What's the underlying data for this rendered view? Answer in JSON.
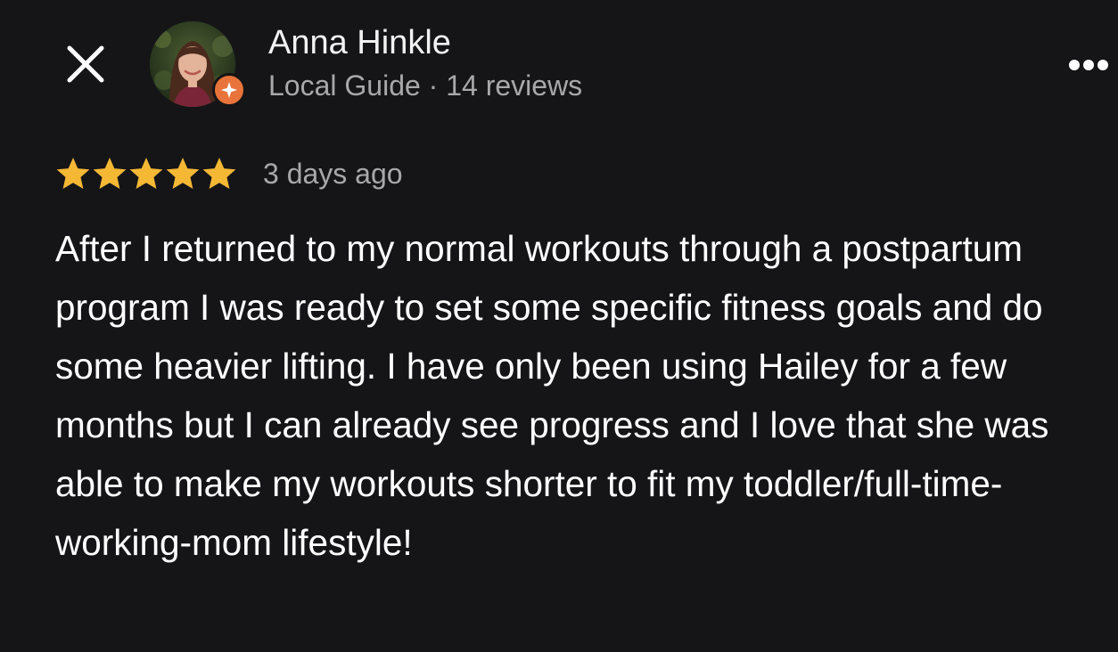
{
  "reviewer": {
    "name": "Anna Hinkle",
    "meta": "Local Guide · 14 reviews",
    "avatar_icon": "user-avatar-photo",
    "badge_icon": "local-guide-badge-icon",
    "badge_color": "#e8743b"
  },
  "review": {
    "rating": 5,
    "max_rating": 5,
    "date": "3 days ago",
    "text": "After I returned to my normal workouts through a postpartum program I was ready to set some specific fitness goals and do some heavier lifting. I have only been using Hailey for a few months but I can already see progress and I love that she was able to make my workouts shorter to fit my toddler/full-time-working-mom lifestyle!"
  },
  "icons": {
    "close": "close-icon",
    "more": "more-options-icon",
    "star": "star-icon"
  },
  "colors": {
    "background": "#151517",
    "star": "#f5b835",
    "secondary_text": "#a8a8ab",
    "primary_text": "#ffffff"
  }
}
